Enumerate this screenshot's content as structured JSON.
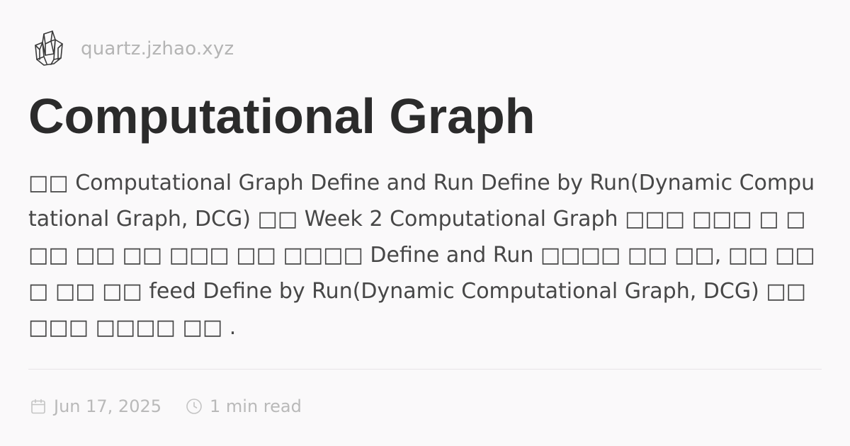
{
  "site": {
    "domain": "quartz.jzhao.xyz",
    "logo_icon": "crystal-cluster-icon"
  },
  "page": {
    "title": "Computational Graph",
    "description": "□□ Computational Graph Define and Run Define by Run(Dynamic Computational Graph, DCG) □□ Week 2 Computational Graph □□□ □□□ □ □□□ □□ □□ □□□ □□ □□□□ Define and Run □□□□ □□ □□, □□ □□□ □□ □□ feed Define by Run(Dynamic Computational Graph, DCG) □□□□□ □□□□ □□ ."
  },
  "meta": {
    "date": "Jun 17, 2025",
    "date_icon": "calendar-icon",
    "read_time": "1 min read",
    "read_time_icon": "clock-icon"
  },
  "colors": {
    "background": "#faf9fa",
    "title": "#2b2b2b",
    "description": "#474747",
    "muted": "#b4b4b4",
    "divider": "#e6e4e6"
  }
}
